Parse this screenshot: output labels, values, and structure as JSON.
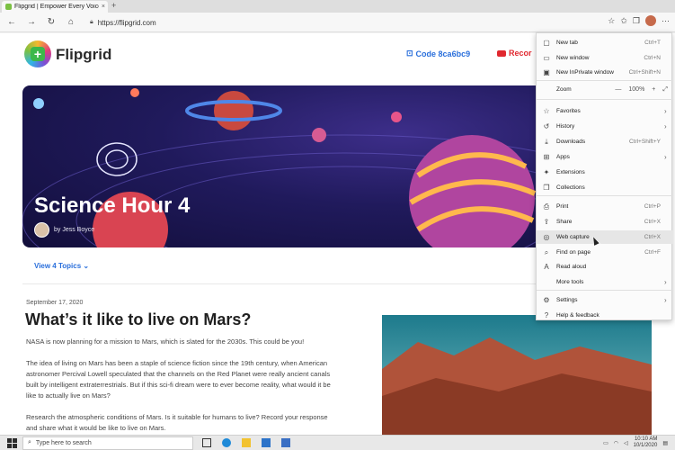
{
  "browser": {
    "tab_title": "Flipgrid | Empower Every Voice",
    "tab_close": "×",
    "new_tab": "+",
    "url": "https://flipgrid.com",
    "nav": {
      "back": "←",
      "forward": "→",
      "refresh": "↻",
      "home": "⌂"
    },
    "toolbar_icons": [
      "star-icon",
      "favorites-icon",
      "collections-icon",
      "profile-icon",
      "more-icon"
    ],
    "more_label": "···"
  },
  "site": {
    "logo_text": "Flipgrid",
    "code_label": "Code 8ca6bc9",
    "record_label": "Recor"
  },
  "hero": {
    "title": "Science Hour 4",
    "byline": "by Jess Boyce"
  },
  "topics_label": "View 4 Topics",
  "article": {
    "date": "September 17, 2020",
    "headline": "What’s it like to live on Mars?",
    "p1": "NASA is now planning for a mission to Mars, which is slated for the 2030s. This could be you!",
    "p2": "The idea of living on Mars has been a staple of science fiction since the 19th century, when American astronomer Percival Lowell speculated that the channels on the Red Planet were really ancient canals built by intelligent extraterrestrials. But if this sci-fi dream were to ever become reality, what would it be like to actually live on Mars?",
    "p3": "Research the atmospheric conditions of Mars. Is it suitable for humans to live? Record your response and share what it would be like to live on Mars."
  },
  "menu": {
    "items": [
      {
        "label": "New tab",
        "shortcut": "Ctrl+T",
        "icon": "new-tab-icon",
        "glyph": "▢"
      },
      {
        "label": "New window",
        "shortcut": "Ctrl+N",
        "icon": "new-window-icon",
        "glyph": "▭"
      },
      {
        "label": "New InPrivate window",
        "shortcut": "Ctrl+Shift+N",
        "icon": "inprivate-icon",
        "glyph": "▣"
      },
      {
        "label": "Favorites",
        "shortcut": "",
        "icon": "favorites-icon",
        "glyph": "☆"
      },
      {
        "label": "History",
        "shortcut": "",
        "icon": "history-icon",
        "glyph": "↺"
      },
      {
        "label": "Downloads",
        "shortcut": "Ctrl+Shift+Y",
        "icon": "downloads-icon",
        "glyph": "⤓"
      },
      {
        "label": "Apps",
        "shortcut": "",
        "icon": "apps-icon",
        "glyph": "⊞"
      },
      {
        "label": "Extensions",
        "shortcut": "",
        "icon": "extensions-icon",
        "glyph": "✦"
      },
      {
        "label": "Collections",
        "shortcut": "",
        "icon": "collections-icon",
        "glyph": "❐"
      },
      {
        "label": "Print",
        "shortcut": "Ctrl+P",
        "icon": "print-icon",
        "glyph": "⎙"
      },
      {
        "label": "Share",
        "shortcut": "Ctrl+X",
        "icon": "share-icon",
        "glyph": "⇪"
      },
      {
        "label": "Web capture",
        "shortcut": "Ctrl+X",
        "icon": "web-capture-icon",
        "glyph": "◎"
      },
      {
        "label": "Find on page",
        "shortcut": "Ctrl+F",
        "icon": "find-icon",
        "glyph": "⌕"
      },
      {
        "label": "Read aloud",
        "shortcut": "",
        "icon": "read-aloud-icon",
        "glyph": "A"
      },
      {
        "label": "More tools",
        "shortcut": "",
        "icon": "more-tools-icon",
        "glyph": ""
      },
      {
        "label": "Settings",
        "shortcut": "",
        "icon": "settings-icon",
        "glyph": "⚙"
      },
      {
        "label": "Help & feedback",
        "shortcut": "",
        "icon": "help-icon",
        "glyph": "?"
      }
    ],
    "zoom_label": "Zoom",
    "zoom_minus": "—",
    "zoom_value": "100%",
    "zoom_plus": "+",
    "zoom_full": "⤢",
    "arrow": "›"
  },
  "taskbar": {
    "search_placeholder": "Type here to search",
    "time": "10:10 AM",
    "date": "10/1/2020",
    "colors": {
      "edge": "#1f8ad8",
      "explorer": "#f2c230",
      "store": "#2c73c9",
      "mail": "#3a6fc4"
    }
  }
}
